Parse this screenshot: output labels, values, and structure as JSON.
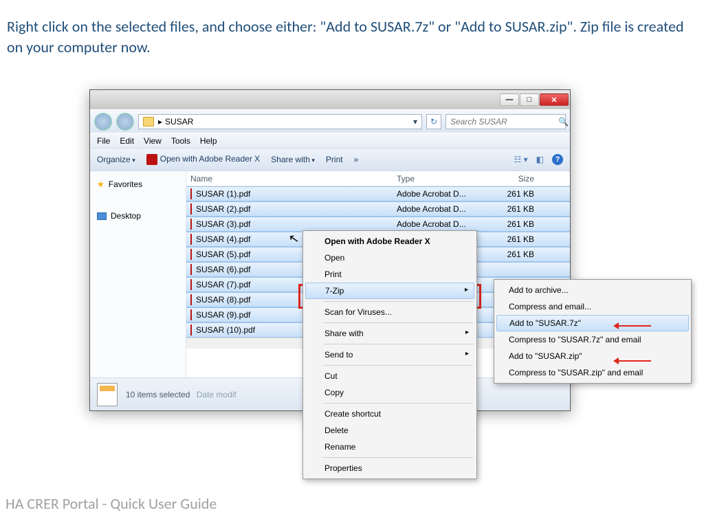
{
  "instruction": "Right click on the selected files, and choose either: \"Add to SUSAR.7z\" or \"Add to SUSAR.zip\". Zip file is created on your computer now.",
  "footer": "HA CRER Portal - Quick User Guide",
  "breadcrumb": "SUSAR",
  "search_placeholder": "Search SUSAR",
  "menu": {
    "file": "File",
    "edit": "Edit",
    "view": "View",
    "tools": "Tools",
    "help": "Help"
  },
  "toolbar": {
    "organize": "Organize",
    "open": "Open with Adobe Reader X",
    "share": "Share with",
    "print": "Print",
    "more": "»"
  },
  "sidebar": {
    "fav": "Favorites",
    "desktop": "Desktop"
  },
  "cols": {
    "name": "Name",
    "type": "Type",
    "size": "Size"
  },
  "file_type": "Adobe Acrobat D...",
  "file_size": "261 KB",
  "files": [
    "SUSAR (1).pdf",
    "SUSAR (2).pdf",
    "SUSAR (3).pdf",
    "SUSAR (4).pdf",
    "SUSAR (5).pdf",
    "SUSAR (6).pdf",
    "SUSAR (7).pdf",
    "SUSAR (8).pdf",
    "SUSAR (9).pdf",
    "SUSAR (10).pdf"
  ],
  "status": {
    "count": "10 items selected",
    "date": "Date modif"
  },
  "ctx": {
    "open_reader": "Open with Adobe Reader X",
    "open": "Open",
    "print": "Print",
    "sevenzip": "7-Zip",
    "scan": "Scan for Viruses...",
    "share": "Share with",
    "sendto": "Send to",
    "cut": "Cut",
    "copy": "Copy",
    "shortcut": "Create shortcut",
    "delete": "Delete",
    "rename": "Rename",
    "props": "Properties"
  },
  "sub": {
    "archive": "Add to archive...",
    "compress_email": "Compress and email...",
    "add_7z": "Add to \"SUSAR.7z\"",
    "compress_7z": "Compress to \"SUSAR.7z\" and email",
    "add_zip": "Add to \"SUSAR.zip\"",
    "compress_zip": "Compress to \"SUSAR.zip\" and email"
  }
}
